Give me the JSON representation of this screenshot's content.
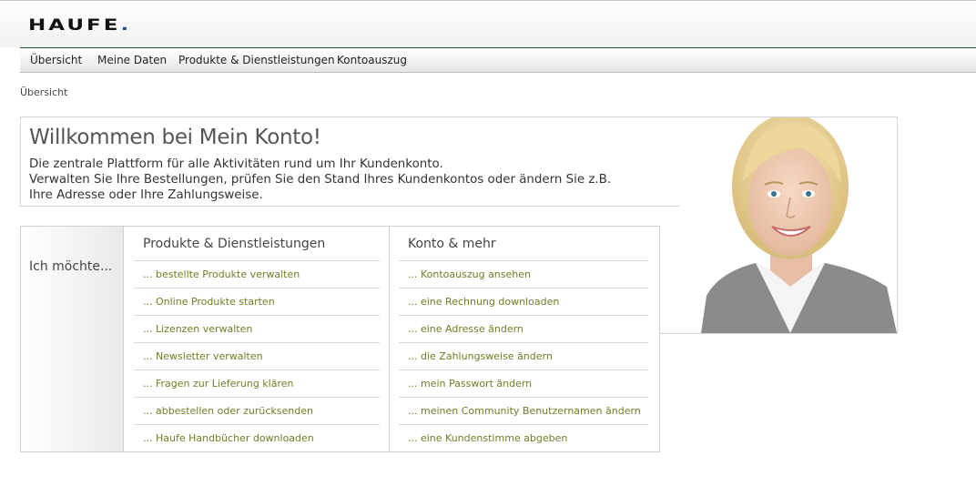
{
  "header": {
    "logo_text": "HAUFE",
    "logo_dot": "."
  },
  "nav": {
    "items": [
      {
        "label": "Übersicht"
      },
      {
        "label": "Meine Daten"
      },
      {
        "label": "Produkte & Dienstleistungen"
      },
      {
        "label": "Kontoauszug"
      }
    ]
  },
  "breadcrumb": "Übersicht",
  "welcome": {
    "title": "Willkommen bei Mein Konto!",
    "lines": [
      "Die zentrale Plattform für alle Aktivitäten rund um Ihr Kundenkonto.",
      "Verwalten Sie Ihre Bestellungen, prüfen Sie den Stand Ihres Kundenkontos oder ändern Sie z.B.",
      "Ihre Adresse oder Ihre Zahlungsweise."
    ]
  },
  "actions": {
    "label": "Ich möchte...",
    "col1": {
      "title": "Produkte & Dienstleistungen",
      "links": [
        "... bestellte Produkte verwalten",
        "... Online Produkte starten",
        "... Lizenzen verwalten",
        "... Newsletter verwalten",
        "... Fragen zur Lieferung klären",
        "... abbestellen oder zurücksenden",
        "... Haufe Handbücher downloaden"
      ]
    },
    "col2": {
      "title": "Konto & mehr",
      "links": [
        "... Kontoauszug ansehen",
        "... eine Rechnung downloaden",
        "... eine Adresse ändern",
        "... die Zahlungsweise ändern",
        "... mein Passwort ändern",
        "... meinen Community Benutzernamen ändern",
        "... eine Kundenstimme abgeben"
      ]
    }
  }
}
